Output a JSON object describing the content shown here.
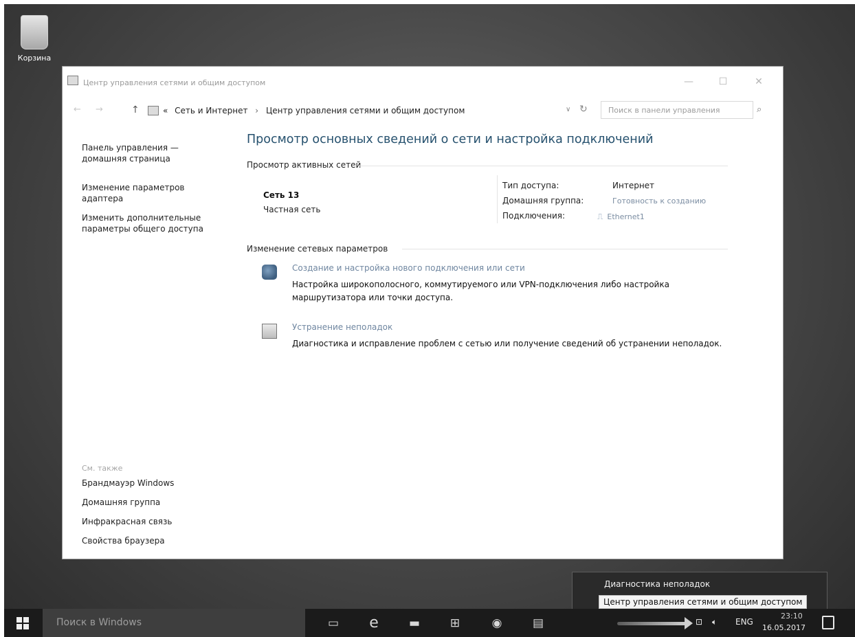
{
  "desktop": {
    "recycle_label": "Корзина"
  },
  "window": {
    "title": "Центр управления сетями и общим доступом",
    "controls": {
      "minimize": "—",
      "maximize": "☐",
      "close": "✕"
    }
  },
  "addressbar": {
    "overflow": "«",
    "crumbs": [
      "Сеть и Интернет",
      "Центр управления сетями и общим доступом"
    ],
    "separator": "›",
    "search_placeholder": "Поиск в панели управления"
  },
  "left_pane": {
    "home": [
      "Панель управления —",
      "домашняя страница"
    ],
    "adapter": [
      "Изменение параметров",
      "адаптера"
    ],
    "sharing": [
      "Изменить дополнительные",
      "параметры общего доступа"
    ],
    "see_also_header": "См. также",
    "see_also": [
      "Брандмауэр Windows",
      "Домашняя группа",
      "Инфракрасная связь",
      "Свойства браузера"
    ]
  },
  "main": {
    "title": "Просмотр основных сведений о сети и настройка подключений",
    "active_networks_header": "Просмотр активных сетей",
    "network": {
      "name": "Сеть 13",
      "type": "Частная сеть",
      "access_label": "Тип доступа:",
      "access_value": "Интернет",
      "homegroup_label": "Домашняя группа:",
      "homegroup_value": "Готовность к созданию",
      "connections_label": "Подключения:",
      "connections_value": "Ethernet1"
    },
    "change_settings_header": "Изменение сетевых параметров",
    "tasks": [
      {
        "icon": "network-setup-icon",
        "link": "Создание и настройка нового подключения или сети",
        "desc": "Настройка широкополосного, коммутируемого или VPN-подключения либо настройка маршрутизатора или точки доступа."
      },
      {
        "icon": "troubleshoot-icon",
        "link": "Устранение неполадок",
        "desc": "Диагностика и исправление проблем с сетью или получение сведений об устранении неполадок."
      }
    ]
  },
  "context_menu": {
    "items": [
      "Диагностика неполадок",
      "Центр управления сетями и общим доступом"
    ]
  },
  "taskbar": {
    "search_placeholder": "Поиск в Windows",
    "lang": "ENG",
    "time": "23:10",
    "date": "16.05.2017"
  }
}
